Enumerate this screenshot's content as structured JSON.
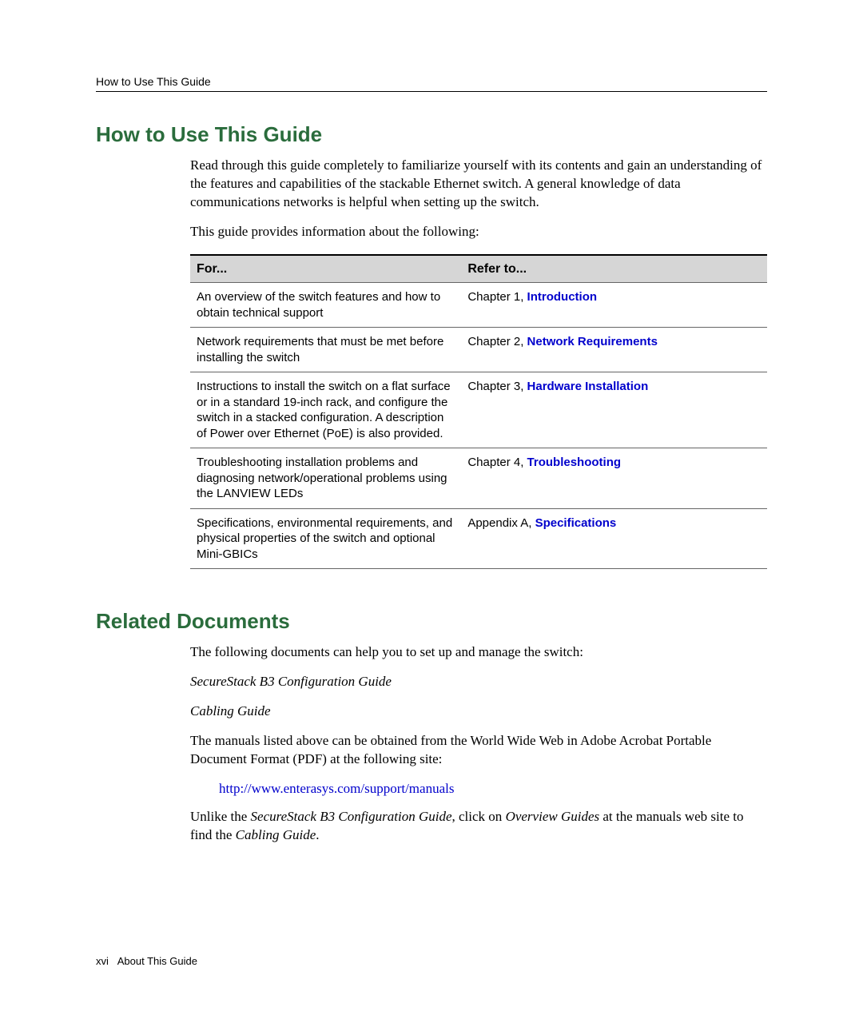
{
  "header": {
    "running_title": "How to Use This Guide"
  },
  "section1": {
    "heading": "How to Use This Guide",
    "para1": "Read through this guide completely to familiarize yourself with its contents and gain an understanding of the features and capabilities of the stackable Ethernet switch. A general knowledge of data communications networks is helpful when setting up the switch.",
    "para2": "This guide provides information about the following:",
    "table": {
      "head_for": "For...",
      "head_refer": "Refer to...",
      "rows": [
        {
          "for": "An overview of the switch features and how to obtain technical support",
          "refer_prefix": "Chapter 1, ",
          "refer_link": "Introduction"
        },
        {
          "for": "Network requirements that must be met before installing the switch",
          "refer_prefix": "Chapter 2, ",
          "refer_link": "Network Requirements"
        },
        {
          "for": "Instructions to install the switch on a flat surface or in a standard 19-inch rack, and configure the switch in a stacked configuration. A description of Power over Ethernet (PoE) is also provided.",
          "refer_prefix": "Chapter 3, ",
          "refer_link": "Hardware Installation"
        },
        {
          "for": "Troubleshooting installation problems and diagnosing network/operational problems using the LANVIEW LEDs",
          "refer_prefix": "Chapter 4, ",
          "refer_link": "Troubleshooting"
        },
        {
          "for": "Specifications, environmental requirements, and physical properties of the switch and optional Mini-GBICs",
          "refer_prefix": "Appendix A, ",
          "refer_link": "Specifications"
        }
      ]
    }
  },
  "section2": {
    "heading": "Related Documents",
    "para1": "The following documents can help you to set up and manage the switch:",
    "doc1": "SecureStack B3 Configuration Guide",
    "doc2": "Cabling Guide",
    "para2": "The manuals listed above can be obtained from the World Wide Web in Adobe Acrobat Portable Document Format (PDF) at the following site:",
    "url": "http://www.enterasys.com/support/manuals",
    "para3_pre": "Unlike the ",
    "para3_i1": "SecureStack B3 Configuration Guide",
    "para3_mid": ", click on ",
    "para3_i2": "Overview Guides",
    "para3_mid2": " at the manuals web site to find the ",
    "para3_i3": "Cabling Guide",
    "para3_end": "."
  },
  "footer": {
    "page_num": "xvi",
    "label": "About This Guide"
  }
}
